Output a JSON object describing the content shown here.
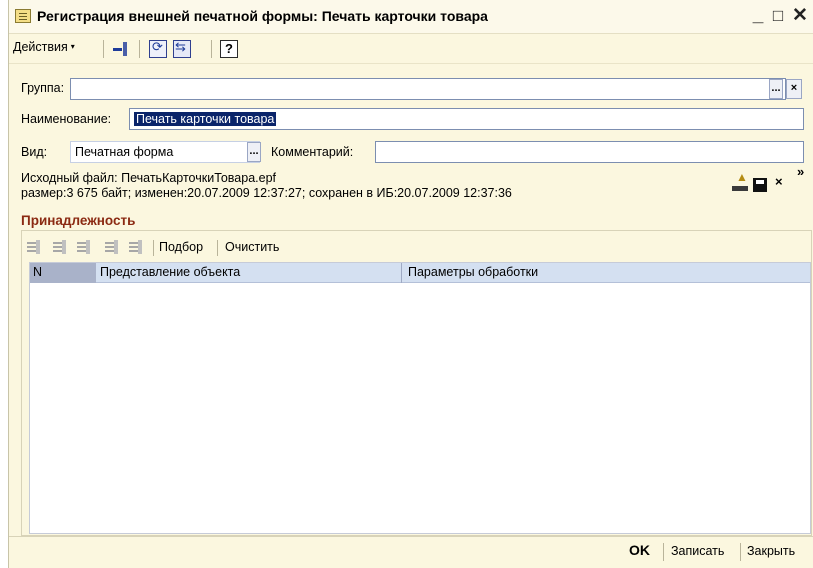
{
  "window": {
    "title": "Регистрация внешней печатной формы: Печать карточки товара",
    "minimize": "_",
    "maximize": "□",
    "close": "✕"
  },
  "toolbar": {
    "actions_label": "Действия",
    "caret": "▾",
    "help_label": "?"
  },
  "form": {
    "group_label": "Группа:",
    "group_value": "",
    "group_select_btn": "...",
    "group_clear_btn": "×",
    "name_label": "Наименование:",
    "name_value": "Печать карточки товара",
    "kind_label": "Вид:",
    "kind_value": "Печатная форма",
    "kind_select_btn": "...",
    "comment_label": "Комментарий:",
    "comment_value": ""
  },
  "file_info": {
    "source_file": "Исходный файл: ПечатьКарточкиТовара.epf",
    "details": "размер:3 675 байт; изменен:20.07.2009 12:37:27; сохранен в ИБ:20.07.2009 12:37:36",
    "delete_glyph": "×",
    "more_glyph": "»"
  },
  "belonging": {
    "title": "Принадлежность",
    "buttons": {
      "pick": "Подбор",
      "clear": "Очистить"
    },
    "columns": {
      "n": "N",
      "object": "Представление объекта",
      "params": "Параметры обработки"
    },
    "rows": []
  },
  "footer": {
    "ok": "OK",
    "save": "Записать",
    "close": "Закрыть"
  },
  "colors": {
    "background": "#fbf7df",
    "section_title": "#8b2a12",
    "grid_header": "#d4e0f1",
    "selection": "#0a246a"
  }
}
